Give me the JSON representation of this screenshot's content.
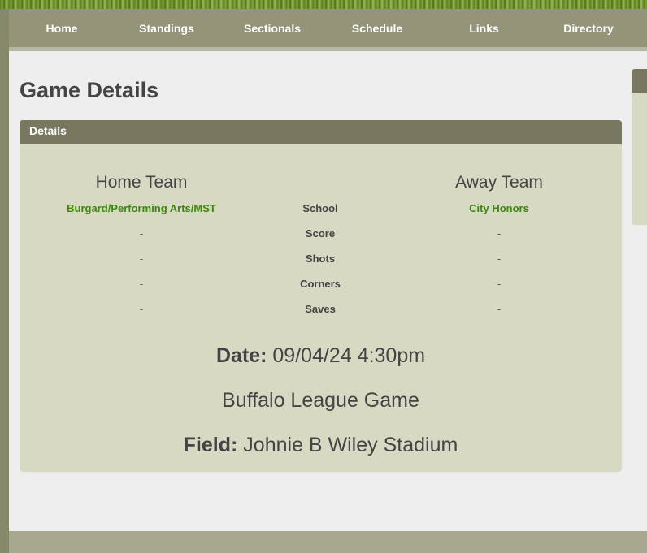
{
  "nav": {
    "items": [
      {
        "label": "Home"
      },
      {
        "label": "Standings"
      },
      {
        "label": "Sectionals"
      },
      {
        "label": "Schedule"
      },
      {
        "label": "Links"
      },
      {
        "label": "Directory"
      }
    ]
  },
  "page": {
    "title": "Game Details"
  },
  "details": {
    "header": "Details",
    "home": {
      "heading": "Home Team",
      "school": "Burgard/Performing Arts/MST",
      "score": "-",
      "shots": "-",
      "corners": "-",
      "saves": "-"
    },
    "away": {
      "heading": "Away Team",
      "school": "City Honors",
      "score": "-",
      "shots": "-",
      "corners": "-",
      "saves": "-"
    },
    "labels": {
      "school": "School",
      "score": "Score",
      "shots": "Shots",
      "corners": "Corners",
      "saves": "Saves"
    },
    "date_label": "Date:",
    "date_value": "09/04/24 4:30pm",
    "game_type": "Buffalo League Game",
    "field_label": "Field:",
    "field_value": "Johnie B Wiley Stadium"
  },
  "colors": {
    "nav_bg": "#939478",
    "panel_header": "#78775f",
    "panel_bg": "#d8d9c2",
    "team_link": "#3a8a0b"
  }
}
